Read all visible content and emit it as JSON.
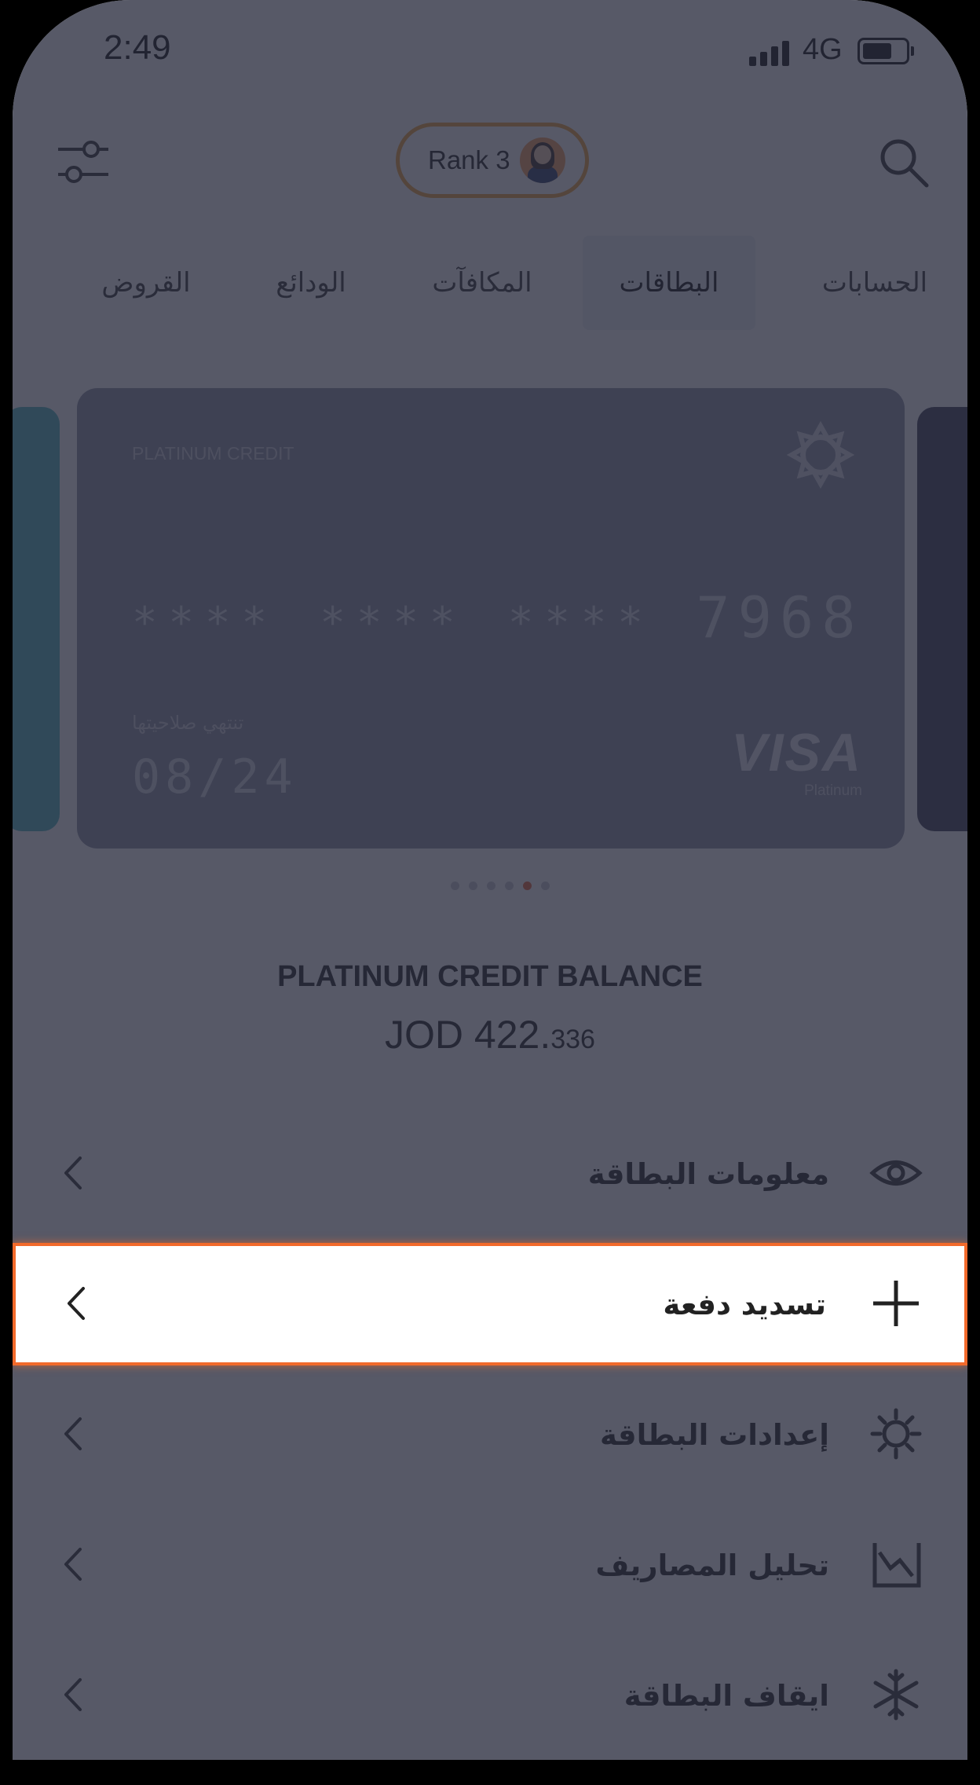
{
  "status_bar": {
    "time": "2:49",
    "network": "4G"
  },
  "header": {
    "rank_label": "Rank 3"
  },
  "tabs": [
    {
      "label": "الحسابات",
      "active": false
    },
    {
      "label": "البطاقات",
      "active": true
    },
    {
      "label": "المكافآت",
      "active": false
    },
    {
      "label": "الودائع",
      "active": false
    },
    {
      "label": "القروض",
      "active": false
    }
  ],
  "card": {
    "type": "PLATINUM CREDIT",
    "masked_groups": [
      "****",
      "****",
      "****"
    ],
    "last_digits": "7968",
    "expiry_label": "تنتهي صلاحيتها",
    "expiry": "08/24",
    "network": "VISA",
    "tier": "Platinum"
  },
  "carousel": {
    "count": 6,
    "active_index": 4
  },
  "balance": {
    "title": "PLATINUM CREDIT BALANCE",
    "amount_main": "JOD 422.",
    "amount_fraction": "336"
  },
  "menu": [
    {
      "label": "معلومات البطاقة",
      "icon": "eye-icon",
      "highlighted": false
    },
    {
      "label": "تسديد دفعة",
      "icon": "plus-icon",
      "highlighted": true
    },
    {
      "label": "إعدادات البطاقة",
      "icon": "gear-icon",
      "highlighted": false
    },
    {
      "label": "تحليل المصاريف",
      "icon": "chart-icon",
      "highlighted": false
    },
    {
      "label": "ايقاف البطاقة",
      "icon": "snowflake-icon",
      "highlighted": false
    }
  ],
  "colors": {
    "highlight_border": "#f26a2b",
    "card_background": "#8e92a6",
    "overlay": "#282a3c",
    "active_dot": "#e8643a"
  }
}
